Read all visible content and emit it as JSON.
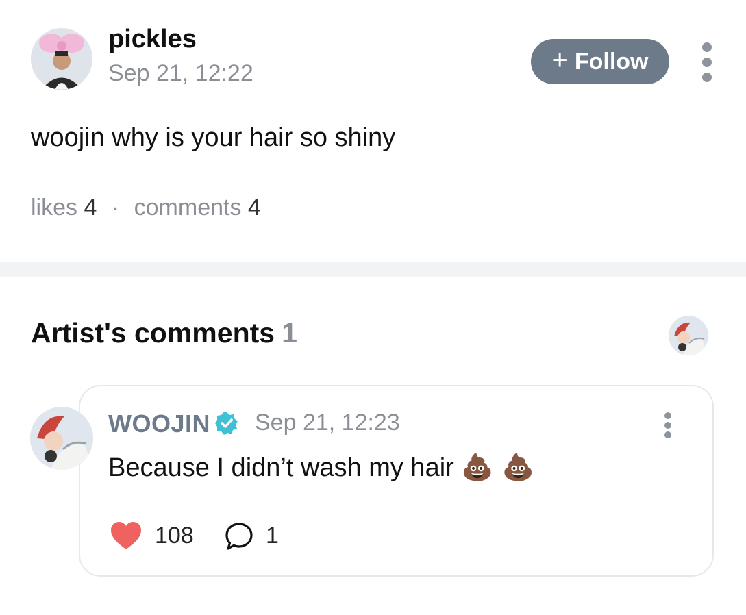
{
  "post": {
    "author": "pickles",
    "date": "Sep 21, 12:22",
    "follow_plus": "+",
    "follow_label": "Follow",
    "text": "woojin why is your hair so shiny",
    "likes_label": "likes",
    "likes_count": "4",
    "separator": "·",
    "comments_label": "comments",
    "comments_count": "4"
  },
  "artist_comments": {
    "title": "Artist's comments",
    "count": "1"
  },
  "comment": {
    "author": "WOOJIN",
    "date": "Sep 21, 12:23",
    "text": "Because I didn’t wash my hair",
    "emoji": "💩 💩",
    "like_count": "108",
    "reply_count": "1"
  },
  "colors": {
    "follow_button": "#6c7a89",
    "verified_badge": "#3ec1d3",
    "heart": "#f0625f",
    "muted_text": "#8b8f95"
  },
  "icons": [
    "more-vertical-icon",
    "verified-badge-icon",
    "heart-icon",
    "speech-bubble-icon"
  ]
}
